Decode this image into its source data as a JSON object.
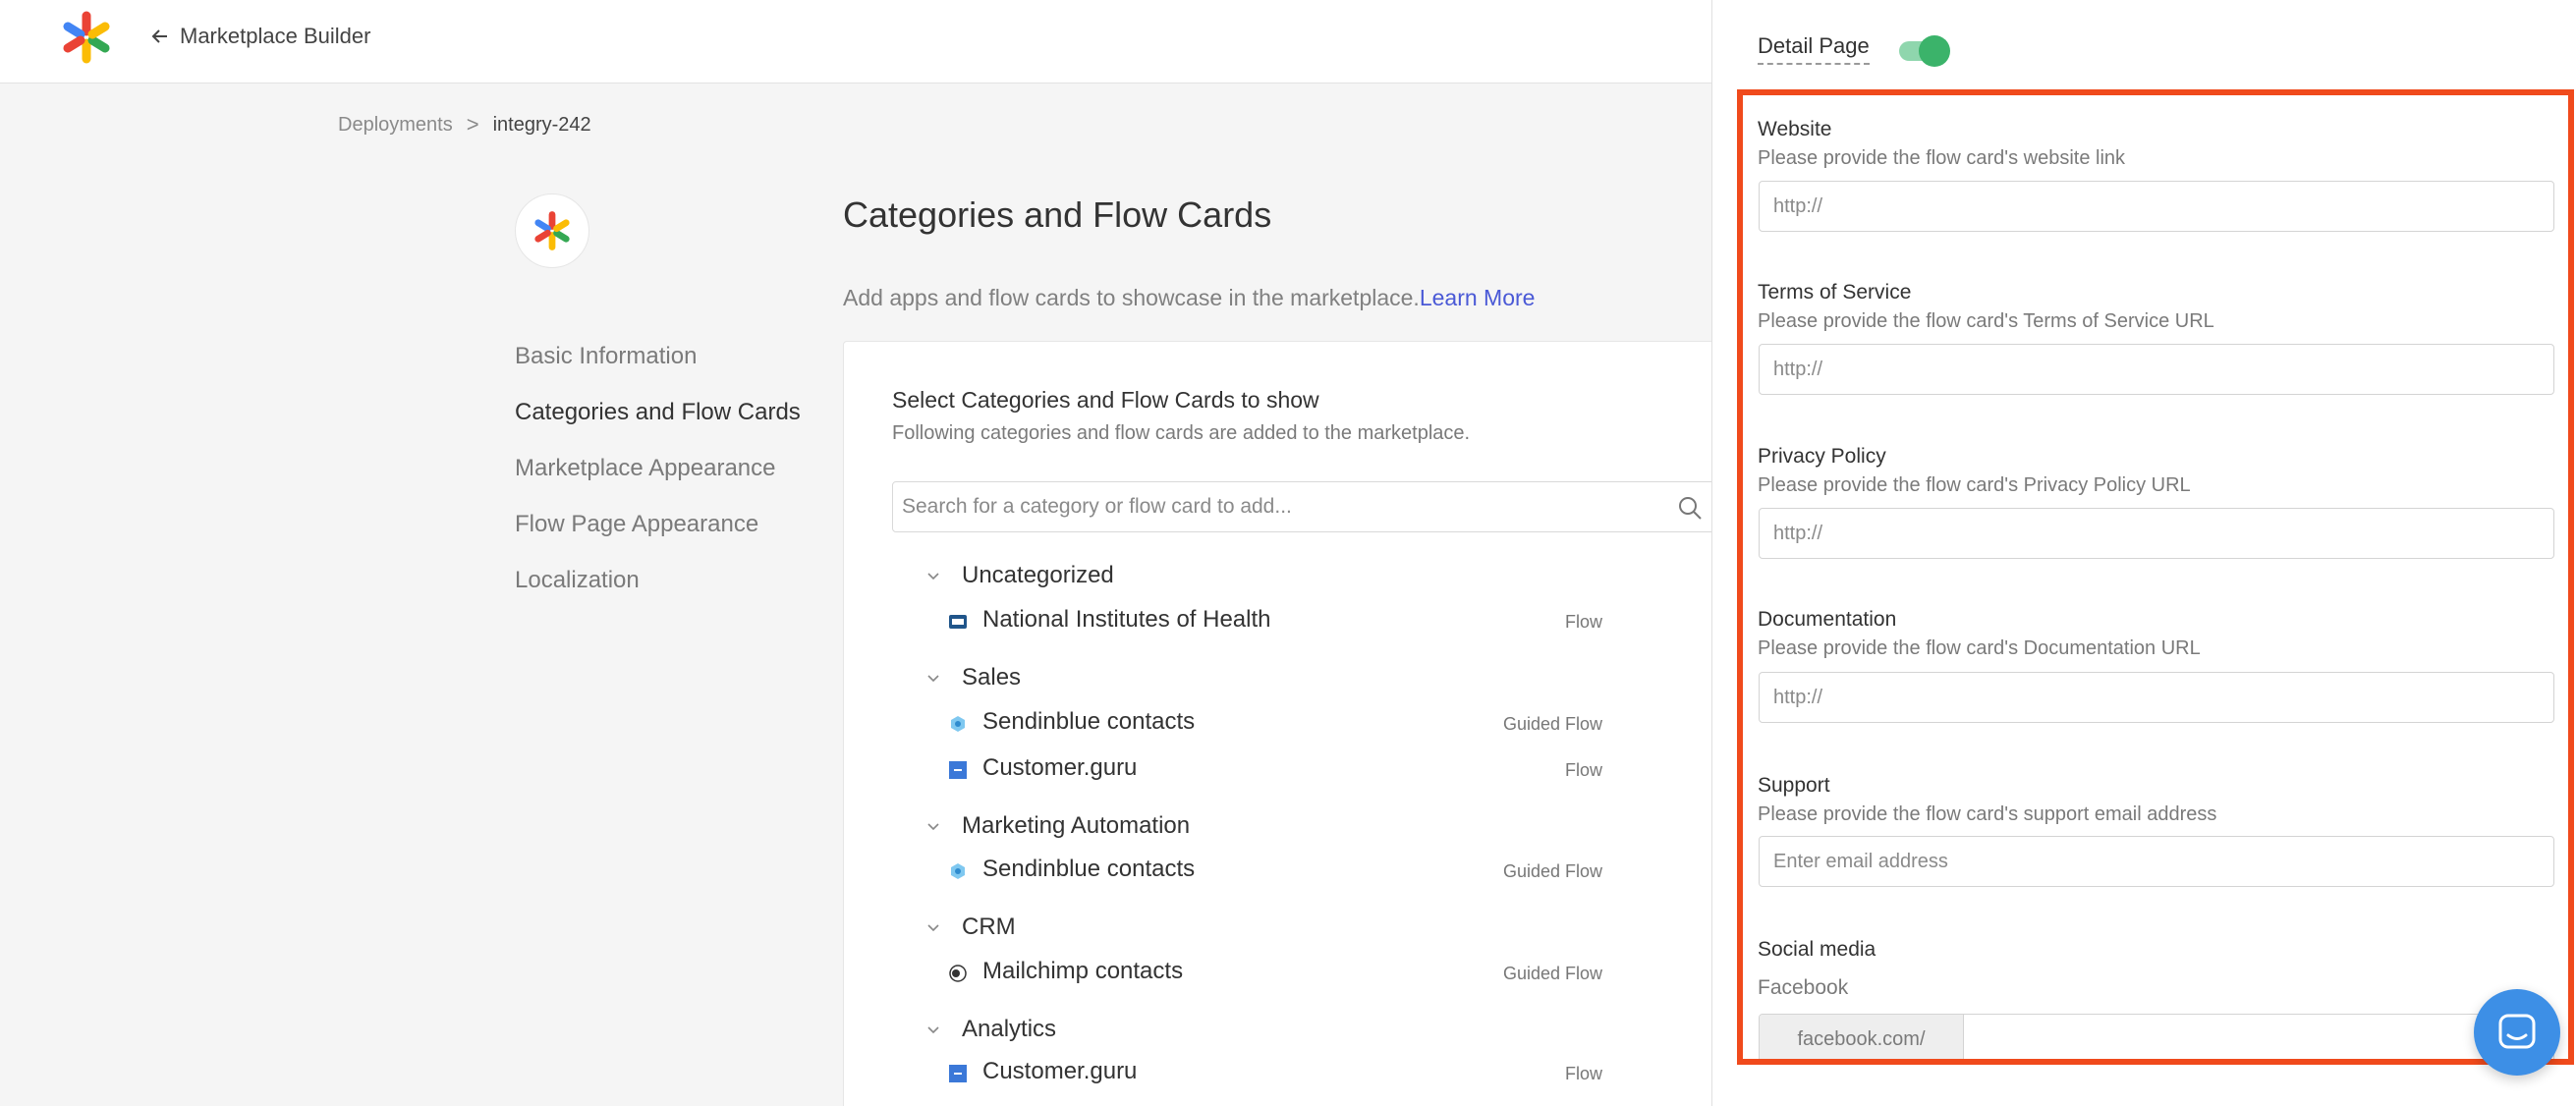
{
  "topbar": {
    "back_label": "Marketplace Builder"
  },
  "breadcrumb": {
    "parent": "Deployments",
    "separator": ">",
    "current": "integry-242"
  },
  "side_nav": {
    "items": [
      {
        "label": "Basic Information",
        "active": false
      },
      {
        "label": "Categories and Flow Cards",
        "active": true
      },
      {
        "label": "Marketplace Appearance",
        "active": false
      },
      {
        "label": "Flow Page Appearance",
        "active": false
      },
      {
        "label": "Localization",
        "active": false
      }
    ]
  },
  "main": {
    "title": "Categories and Flow Cards",
    "subtitle": "Add apps and flow cards to showcase in the marketplace.",
    "learn_more": "Learn More",
    "card": {
      "title": "Select Categories and Flow Cards to show",
      "subtitle": "Following categories and flow cards are added to the marketplace.",
      "search_placeholder": "Search for a category or flow card to add...",
      "categories": [
        {
          "name": "Uncategorized",
          "flows": [
            {
              "name": "National Institutes of Health",
              "type": "Flow",
              "icon": "nih-app-icon"
            }
          ]
        },
        {
          "name": "Sales",
          "flows": [
            {
              "name": "Sendinblue contacts",
              "type": "Guided Flow",
              "icon": "sendinblue-app-icon"
            },
            {
              "name": "Customer.guru",
              "type": "Flow",
              "icon": "customer-guru-app-icon"
            }
          ]
        },
        {
          "name": "Marketing Automation",
          "flows": [
            {
              "name": "Sendinblue contacts",
              "type": "Guided Flow",
              "icon": "sendinblue-app-icon"
            }
          ]
        },
        {
          "name": "CRM",
          "flows": [
            {
              "name": "Mailchimp contacts",
              "type": "Guided Flow",
              "icon": "mailchimp-app-icon"
            }
          ]
        },
        {
          "name": "Analytics",
          "flows": [
            {
              "name": "Customer.guru",
              "type": "Flow",
              "icon": "customer-guru-app-icon"
            }
          ]
        }
      ]
    }
  },
  "panel": {
    "detail_page_label": "Detail Page",
    "detail_page_enabled": true,
    "fields": {
      "website": {
        "label": "Website",
        "help": "Please provide the flow card's website link",
        "placeholder": "http://",
        "value": ""
      },
      "terms": {
        "label": "Terms of Service",
        "help": "Please provide the flow card's Terms of Service URL",
        "placeholder": "http://",
        "value": ""
      },
      "privacy": {
        "label": "Privacy Policy",
        "help": "Please provide the flow card's Privacy Policy URL",
        "placeholder": "http://",
        "value": ""
      },
      "documentation": {
        "label": "Documentation",
        "help": "Please provide the flow card's Documentation URL",
        "placeholder": "http://",
        "value": ""
      },
      "support": {
        "label": "Support",
        "help": "Please provide the flow card's support email address",
        "placeholder": "Enter email address",
        "value": ""
      }
    },
    "social": {
      "label": "Social media",
      "facebook_label": "Facebook",
      "facebook_prefix": "facebook.com/"
    }
  },
  "colors": {
    "highlight": "#f04a1c",
    "toggle_on": "#3bb36a",
    "link": "#4a59d6",
    "chat_button": "#3d8fe6"
  }
}
